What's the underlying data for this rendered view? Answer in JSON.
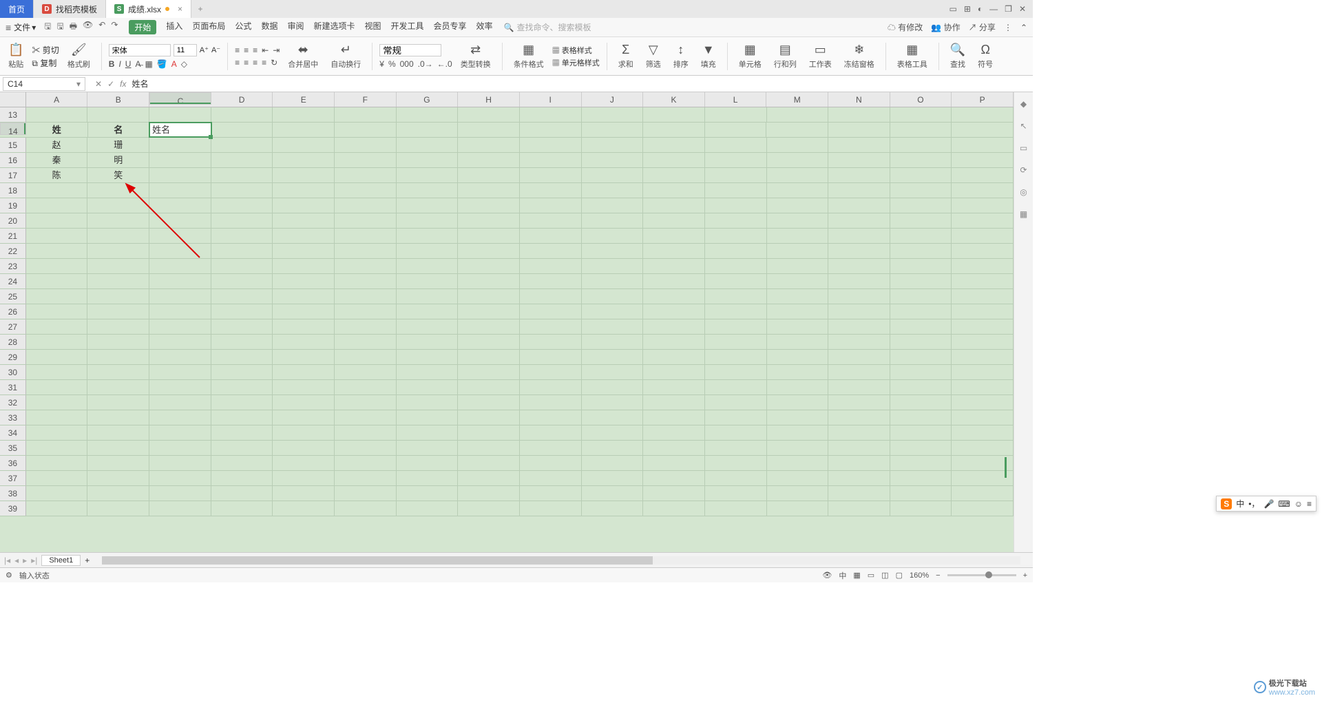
{
  "titlebar": {
    "home": "首页",
    "tab1": "找稻壳模板",
    "tab2": "成绩.xlsx"
  },
  "menubar": {
    "file": "文件",
    "tabs": [
      "开始",
      "插入",
      "页面布局",
      "公式",
      "数据",
      "审阅",
      "新建选项卡",
      "视图",
      "开发工具",
      "会员专享",
      "效率"
    ],
    "search": "查找命令、搜索模板",
    "right": {
      "changes": "有修改",
      "coop": "协作",
      "share": "分享"
    }
  },
  "ribbon": {
    "paste": "粘贴",
    "cut": "剪切",
    "copy": "复制",
    "format_painter": "格式刷",
    "font_name": "宋体",
    "font_size": "11",
    "merge": "合并居中",
    "wrap": "自动换行",
    "number_format": "常规",
    "type_convert": "类型转换",
    "cond_fmt": "条件格式",
    "table_style": "表格样式",
    "cell_style": "单元格样式",
    "sum": "求和",
    "filter": "筛选",
    "sort": "排序",
    "fill": "填充",
    "cells": "单元格",
    "rowcol": "行和列",
    "sheet": "工作表",
    "freeze": "冻结窗格",
    "table_tools": "表格工具",
    "find": "查找",
    "symbol": "符号"
  },
  "formulabar": {
    "ref": "C14",
    "formula": "姓名"
  },
  "columns": [
    "A",
    "B",
    "C",
    "D",
    "E",
    "F",
    "G",
    "H",
    "I",
    "J",
    "K",
    "L",
    "M",
    "N",
    "O",
    "P"
  ],
  "row_start": 13,
  "row_end": 39,
  "active": {
    "row": 14,
    "col": "C"
  },
  "cells": {
    "A14": "姓",
    "B14": "名",
    "C14": "姓名",
    "A15": "赵",
    "B15": "珊",
    "A16": "秦",
    "B16": "明",
    "A17": "陈",
    "B17": "笑"
  },
  "bold_cells": [
    "A14",
    "B14"
  ],
  "sheet": {
    "name": "Sheet1"
  },
  "status": {
    "mode": "输入状态",
    "zoom": "160%"
  },
  "ime": {
    "lang": "中"
  },
  "watermark": {
    "name": "极光下载站",
    "url": "www.xz7.com"
  }
}
